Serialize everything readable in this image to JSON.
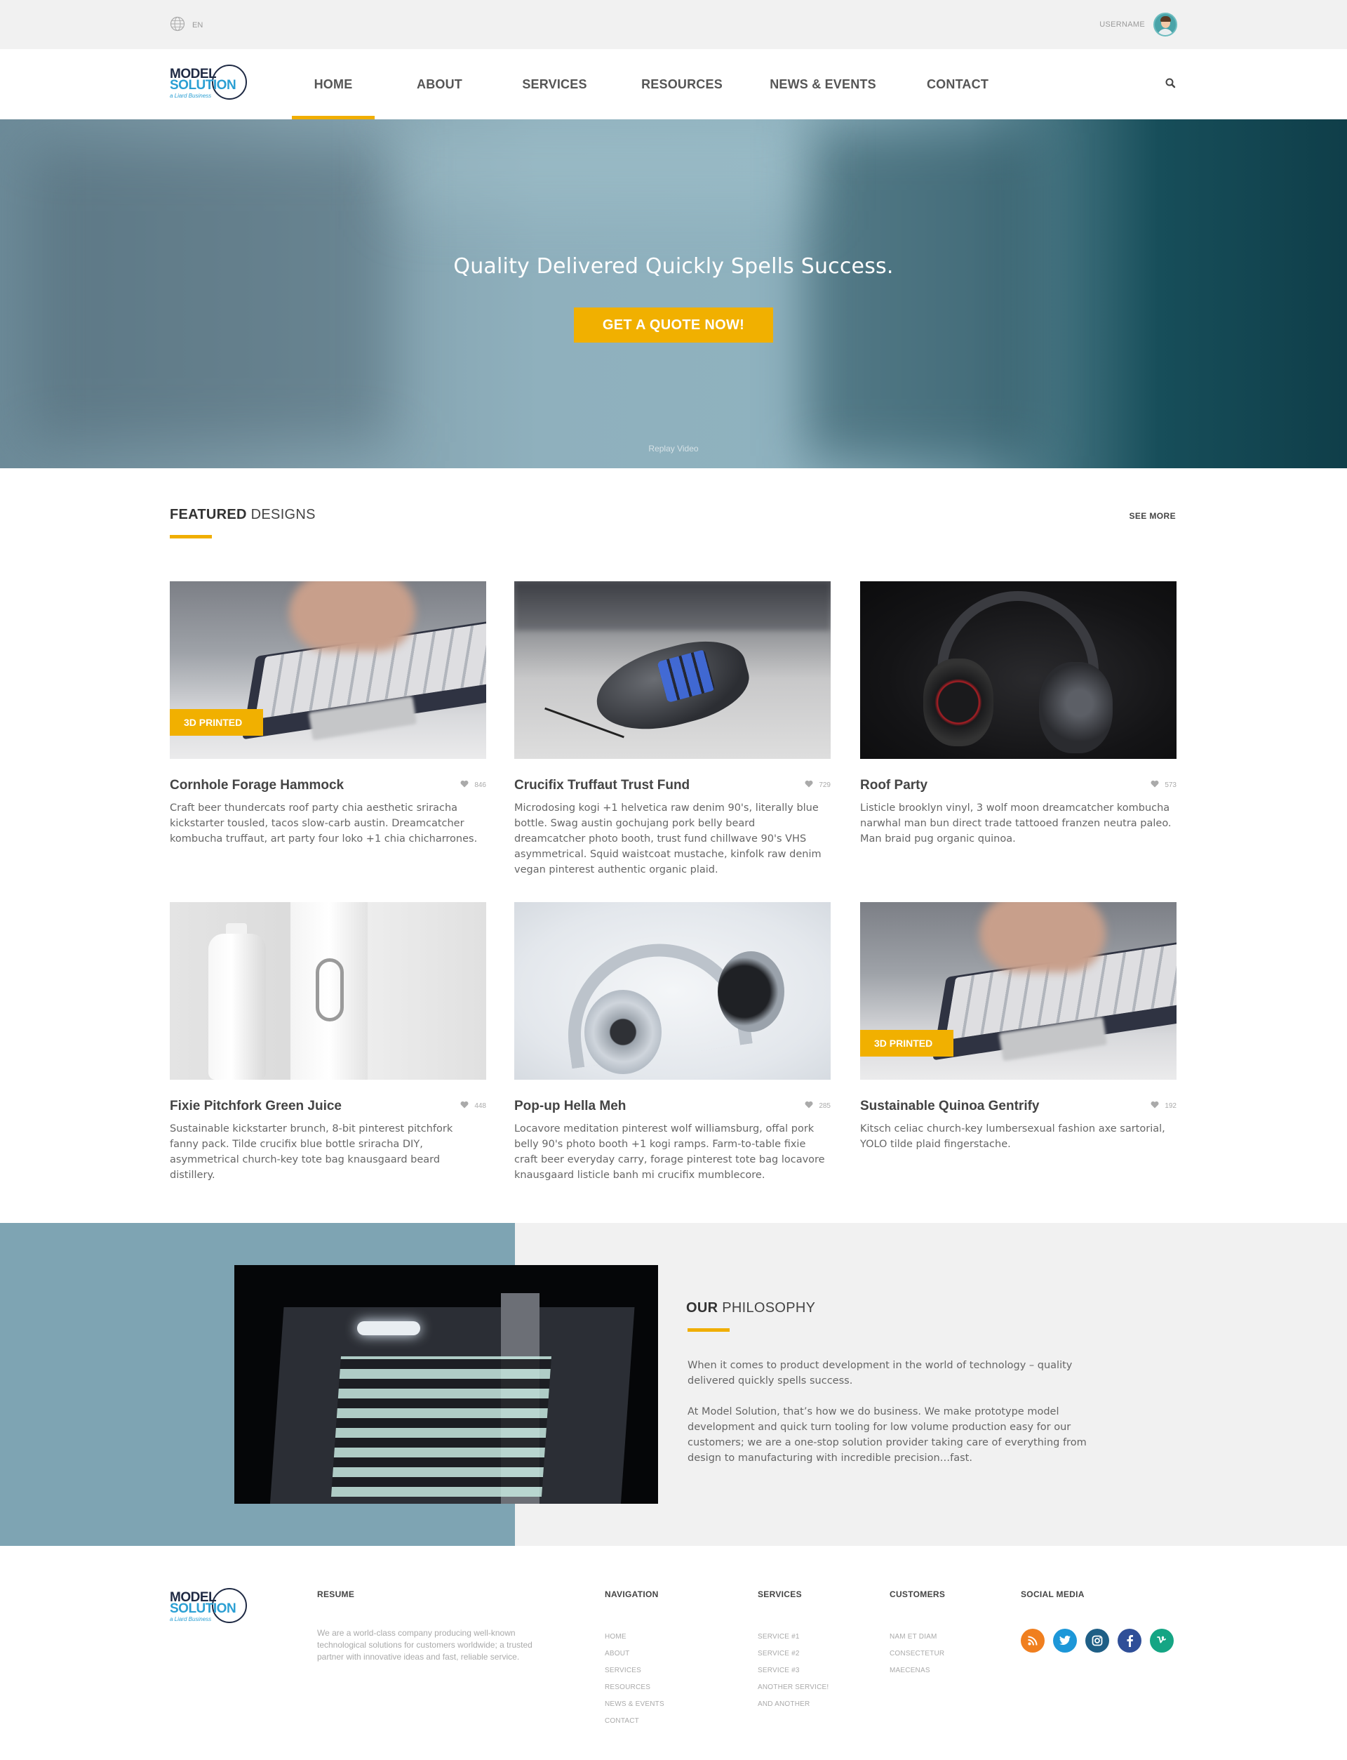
{
  "topbar": {
    "language": "EN",
    "username": "USERNAME"
  },
  "nav": {
    "items": [
      {
        "label": "HOME",
        "active": true
      },
      {
        "label": "ABOUT",
        "active": false
      },
      {
        "label": "SERVICES",
        "active": false
      },
      {
        "label": "RESOURCES",
        "active": false
      },
      {
        "label": "NEWS & EVENTS",
        "active": false
      },
      {
        "label": "CONTACT",
        "active": false
      }
    ]
  },
  "brand": {
    "line1": "MODEL",
    "line2": "SOLUTION",
    "tagline": "a Liard Business"
  },
  "hero": {
    "title": "Quality Delivered Quickly Spells Success.",
    "cta": "GET A QUOTE NOW!",
    "replay": "Replay Video"
  },
  "featured": {
    "heading_bold": "FEATURED",
    "heading_rest": " DESIGNS",
    "see_more": "SEE MORE",
    "cards": [
      {
        "title": "Cornhole Forage Hammock",
        "likes": "846",
        "badge": "3D PRINTED",
        "desc": "Craft beer thundercats roof party chia aesthetic sriracha kickstarter tousled, tacos slow-carb austin. Dreamcatcher kombucha truffaut, art party four loko +1 chia chicharrones."
      },
      {
        "title": "Crucifix Truffaut Trust Fund",
        "likes": "729",
        "badge": "",
        "desc": "Microdosing kogi +1 helvetica raw denim 90's, literally blue bottle. Swag austin gochujang pork belly beard dreamcatcher photo booth, trust fund chillwave 90's VHS asymmetrical. Squid waistcoat mustache, kinfolk raw denim vegan pinterest authentic organic plaid."
      },
      {
        "title": "Roof Party",
        "likes": "573",
        "badge": "",
        "desc": "Listicle brooklyn vinyl, 3 wolf moon dreamcatcher kombucha narwhal man bun direct trade tattooed franzen neutra paleo. Man braid pug organic quinoa."
      },
      {
        "title": "Fixie Pitchfork Green Juice",
        "likes": "448",
        "badge": "",
        "desc": "Sustainable kickstarter brunch, 8-bit pinterest pitchfork fanny pack. Tilde crucifix blue bottle sriracha DIY, asymmetrical church-key tote bag knausgaard beard distillery."
      },
      {
        "title": "Pop-up Hella Meh",
        "likes": "285",
        "badge": "",
        "desc": "Locavore meditation pinterest wolf williamsburg, offal pork belly 90's photo booth +1 kogi ramps. Farm-to-table fixie craft beer everyday carry, forage pinterest tote bag locavore knausgaard listicle banh mi crucifix mumblecore."
      },
      {
        "title": "Sustainable Quinoa Gentrify",
        "likes": "192",
        "badge": "3D PRINTED",
        "desc": "Kitsch celiac church-key lumbersexual fashion axe sartorial, YOLO tilde plaid fingerstache."
      }
    ]
  },
  "philosophy": {
    "heading_bold": "OUR",
    "heading_rest": " PHILOSOPHY",
    "p1": "When it comes to product development in the world of technology – quality delivered quickly spells success.",
    "p2": "At Model Solution, that’s how we do business. We make prototype model development and quick turn tooling for low volume production easy for our customers; we are a one-stop solution provider taking care of everything from design to manufacturing with incredible precision…fast."
  },
  "footer": {
    "resume": {
      "title": "RESUME",
      "text": "We are a world-class company producing  well-known technological solutions for  customers worldwide; a trusted partner with innovative ideas and fast, reliable service."
    },
    "navigation": {
      "title": "NAVIGATION",
      "links": [
        "HOME",
        "ABOUT",
        "SERVICES",
        "RESOURCES",
        "NEWS & EVENTS",
        "CONTACT"
      ]
    },
    "services": {
      "title": "SERVICES",
      "links": [
        "SERVICE #1",
        "SERVICE #2",
        "SERVICE #3",
        "ANOTHER SERVICE!",
        "AND ANOTHER"
      ]
    },
    "customers": {
      "title": "CUSTOMERS",
      "links": [
        "NAM ET DIAM",
        "CONSECTETUR",
        "MAECENAS"
      ]
    },
    "social": {
      "title": "SOCIAL MEDIA",
      "icons": [
        {
          "name": "rss-icon",
          "color": "#f07f1f"
        },
        {
          "name": "twitter-icon",
          "color": "#1d97d8"
        },
        {
          "name": "instagram-icon",
          "color": "#1f5f86"
        },
        {
          "name": "facebook-icon",
          "color": "#2f4f98"
        },
        {
          "name": "vine-icon",
          "color": "#15a584"
        }
      ]
    }
  },
  "colors": {
    "accent": "#f1b000",
    "philosophy_panel": "#7ea4b3"
  }
}
